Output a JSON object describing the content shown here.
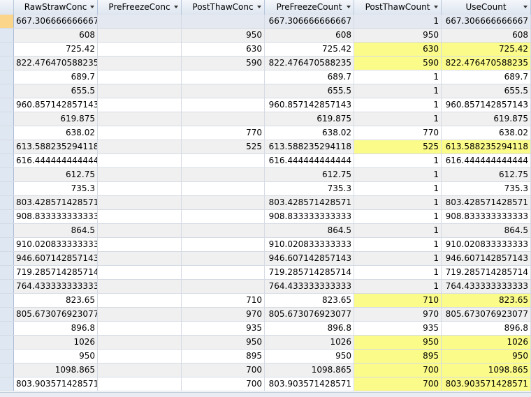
{
  "columns": [
    "RawStrawConc",
    "PreFreezeConc",
    "PostThawConc",
    "PreFreezeCount",
    "PostThawCount",
    "UseCount"
  ],
  "rows": [
    [
      "667.306666666667",
      "",
      "",
      "667.306666666667",
      "1",
      "667.306666666667"
    ],
    [
      "608",
      "",
      "950",
      "608",
      "950",
      "608"
    ],
    [
      "725.42",
      "",
      "630",
      "725.42",
      "630",
      "725.42"
    ],
    [
      "822.476470588235",
      "",
      "590",
      "822.476470588235",
      "590",
      "822.476470588235"
    ],
    [
      "689.7",
      "",
      "",
      "689.7",
      "1",
      "689.7"
    ],
    [
      "655.5",
      "",
      "",
      "655.5",
      "1",
      "655.5"
    ],
    [
      "960.857142857143",
      "",
      "",
      "960.857142857143",
      "1",
      "960.857142857143"
    ],
    [
      "619.875",
      "",
      "",
      "619.875",
      "1",
      "619.875"
    ],
    [
      "638.02",
      "",
      "770",
      "638.02",
      "770",
      "638.02"
    ],
    [
      "613.588235294118",
      "",
      "525",
      "613.588235294118",
      "525",
      "613.588235294118"
    ],
    [
      "616.444444444444",
      "",
      "",
      "616.444444444444",
      "1",
      "616.444444444444"
    ],
    [
      "612.75",
      "",
      "",
      "612.75",
      "1",
      "612.75"
    ],
    [
      "735.3",
      "",
      "",
      "735.3",
      "1",
      "735.3"
    ],
    [
      "803.428571428571",
      "",
      "",
      "803.428571428571",
      "1",
      "803.428571428571"
    ],
    [
      "908.833333333333",
      "",
      "",
      "908.833333333333",
      "1",
      "908.833333333333"
    ],
    [
      "864.5",
      "",
      "",
      "864.5",
      "1",
      "864.5"
    ],
    [
      "910.020833333333",
      "",
      "",
      "910.020833333333",
      "1",
      "910.020833333333"
    ],
    [
      "946.607142857143",
      "",
      "",
      "946.607142857143",
      "1",
      "946.607142857143"
    ],
    [
      "719.285714285714",
      "",
      "",
      "719.285714285714",
      "1",
      "719.285714285714"
    ],
    [
      "764.433333333333",
      "",
      "",
      "764.433333333333",
      "1",
      "764.433333333333"
    ],
    [
      "823.65",
      "",
      "710",
      "823.65",
      "710",
      "823.65"
    ],
    [
      "805.673076923077",
      "",
      "970",
      "805.673076923077",
      "970",
      "805.673076923077"
    ],
    [
      "896.8",
      "",
      "935",
      "896.8",
      "935",
      "896.8"
    ],
    [
      "1026",
      "",
      "950",
      "1026",
      "950",
      "1026"
    ],
    [
      "950",
      "",
      "895",
      "950",
      "895",
      "950"
    ],
    [
      "1098.865",
      "",
      "700",
      "1098.865",
      "700",
      "1098.865"
    ],
    [
      "803.903571428571",
      "",
      "700",
      "803.903571428571",
      "700",
      "803.903571428571"
    ]
  ],
  "highlighted_rows": [
    2,
    3,
    9,
    20,
    23,
    24,
    25,
    26
  ],
  "current_row": 0,
  "colors": {
    "highlight": "#fbfb8a",
    "header_top": "#f4f7fb",
    "header_bottom": "#dde5ef",
    "current_selector": "#fbd58a"
  }
}
